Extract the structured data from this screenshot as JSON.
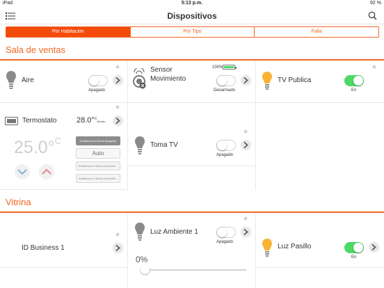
{
  "status_bar": {
    "device": "iPad",
    "time": "5:13 p.m.",
    "battery": "92 %"
  },
  "nav": {
    "title": "Dispositivos"
  },
  "segments": [
    {
      "label": "Por Habitación",
      "active": true
    },
    {
      "label": "Por Tipo",
      "active": false
    },
    {
      "label": "Falla",
      "active": false
    }
  ],
  "sections": [
    {
      "title": "Sala de ventas"
    },
    {
      "title": "Vitrina"
    }
  ],
  "devices": {
    "aire": {
      "name": "Aire",
      "state": "Apagado",
      "on": false,
      "icon": "light-bulb-icon"
    },
    "sensor": {
      "name_line1": "Sensor",
      "name_line2": "Movimiento",
      "state": "Desarmado",
      "battery_pct": "100%",
      "on": false,
      "icon": "motion-sensor-icon"
    },
    "tv_publica": {
      "name": "TV Publica",
      "state": "En",
      "on": true,
      "icon": "light-bulb-icon",
      "icon_color": "#f9b233"
    },
    "termostato": {
      "name": "Termostato",
      "current_temp": "28.0°",
      "current_unit": "C",
      "current_label": "Dentro",
      "setpoint": "25.0°",
      "setpoint_unit": "C",
      "modes": [
        "Establezca el Modo Apagado",
        "Auto",
        "Establezca el Modo Encendid...",
        "Establezca el Modo Encendid..."
      ],
      "active_mode": 0,
      "icon": "thermostat-icon"
    },
    "toma_tv": {
      "name": "Toma TV",
      "state": "Apagado",
      "on": false,
      "icon": "light-bulb-icon"
    },
    "id_business": {
      "name": "ID Business 1"
    },
    "luz_ambiente": {
      "name": "Luz  Ambiente 1",
      "state": "Apagado",
      "on": false,
      "level": "0%",
      "level_value": 0,
      "icon": "light-bulb-icon"
    },
    "luz_pasillo": {
      "name": "Luz Pasillo",
      "state": "En",
      "on": true,
      "icon": "light-bulb-icon",
      "icon_color": "#f9b233"
    }
  },
  "colors": {
    "accent": "#f26522",
    "active_segment": "#f44b0c",
    "toggle_on": "#4cd964",
    "bulb_off": "#8a8a8a",
    "bulb_on": "#f9b233"
  }
}
